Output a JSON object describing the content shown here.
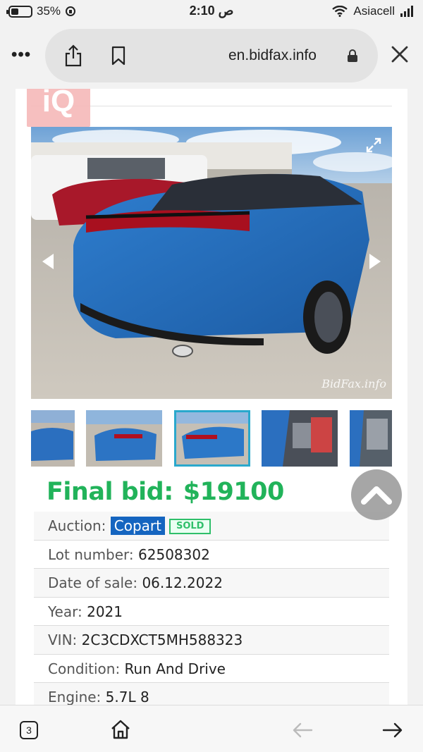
{
  "status_bar": {
    "battery": "35%",
    "time": "2:10 ص",
    "carrier": "Asiacell"
  },
  "browser": {
    "url": "en.bidfax.info",
    "tab_count": "3"
  },
  "site": {
    "logo_text": "iQ",
    "watermark": "BidFax.info"
  },
  "listing": {
    "final_bid_label": "Final bid:",
    "final_bid_amount": "$19100",
    "auction_label": "Auction: ",
    "auction_value": "Copart",
    "auction_status": "SOLD",
    "lot_label": "Lot number: ",
    "lot_value": "62508302",
    "date_label": "Date of sale: ",
    "date_value": "06.12.2022",
    "year_label": "Year: ",
    "year_value": "2021",
    "vin_label": "VIN: ",
    "vin_value": "2C3CDXCT5MH588323",
    "condition_label": "Condition: ",
    "condition_value": "Run And Drive",
    "engine_label": "Engine: ",
    "engine_value": "5.7L 8"
  },
  "colors": {
    "accent_green": "#21b35a",
    "copart_blue": "#1565c0",
    "thumb_active": "#2aa8cc"
  }
}
